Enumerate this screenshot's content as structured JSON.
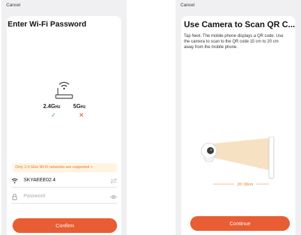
{
  "left_screen": {
    "cancel": "Cancel",
    "title": "Enter Wi-Fi Password",
    "bands": [
      {
        "label": "2.4G",
        "unit": "Hz",
        "mark": "✓"
      },
      {
        "label": "5G",
        "unit": "Hz",
        "mark": "✕"
      }
    ],
    "notice": "Only 2.4 GHz Wi-Fi networks are supported >",
    "wifi_name": "SKYAEEE02.4",
    "password_placeholder": "Password",
    "confirm": "Confirm"
  },
  "right_screen": {
    "cancel": "Cancel",
    "title": "Use Camera to Scan QR C...",
    "description": "Tap Next. The mobile phone displays a QR code. Use the camera to scan to the QR code 15 cm to 20 cm away from the mobile phone.",
    "distance": "20~30cm",
    "continue": "Continue"
  },
  "colors": {
    "accent": "#e85d33",
    "ok": "#33b249",
    "error": "#e24b2c",
    "notice_bg": "#fff4e2",
    "notice_text": "#f0701c"
  }
}
